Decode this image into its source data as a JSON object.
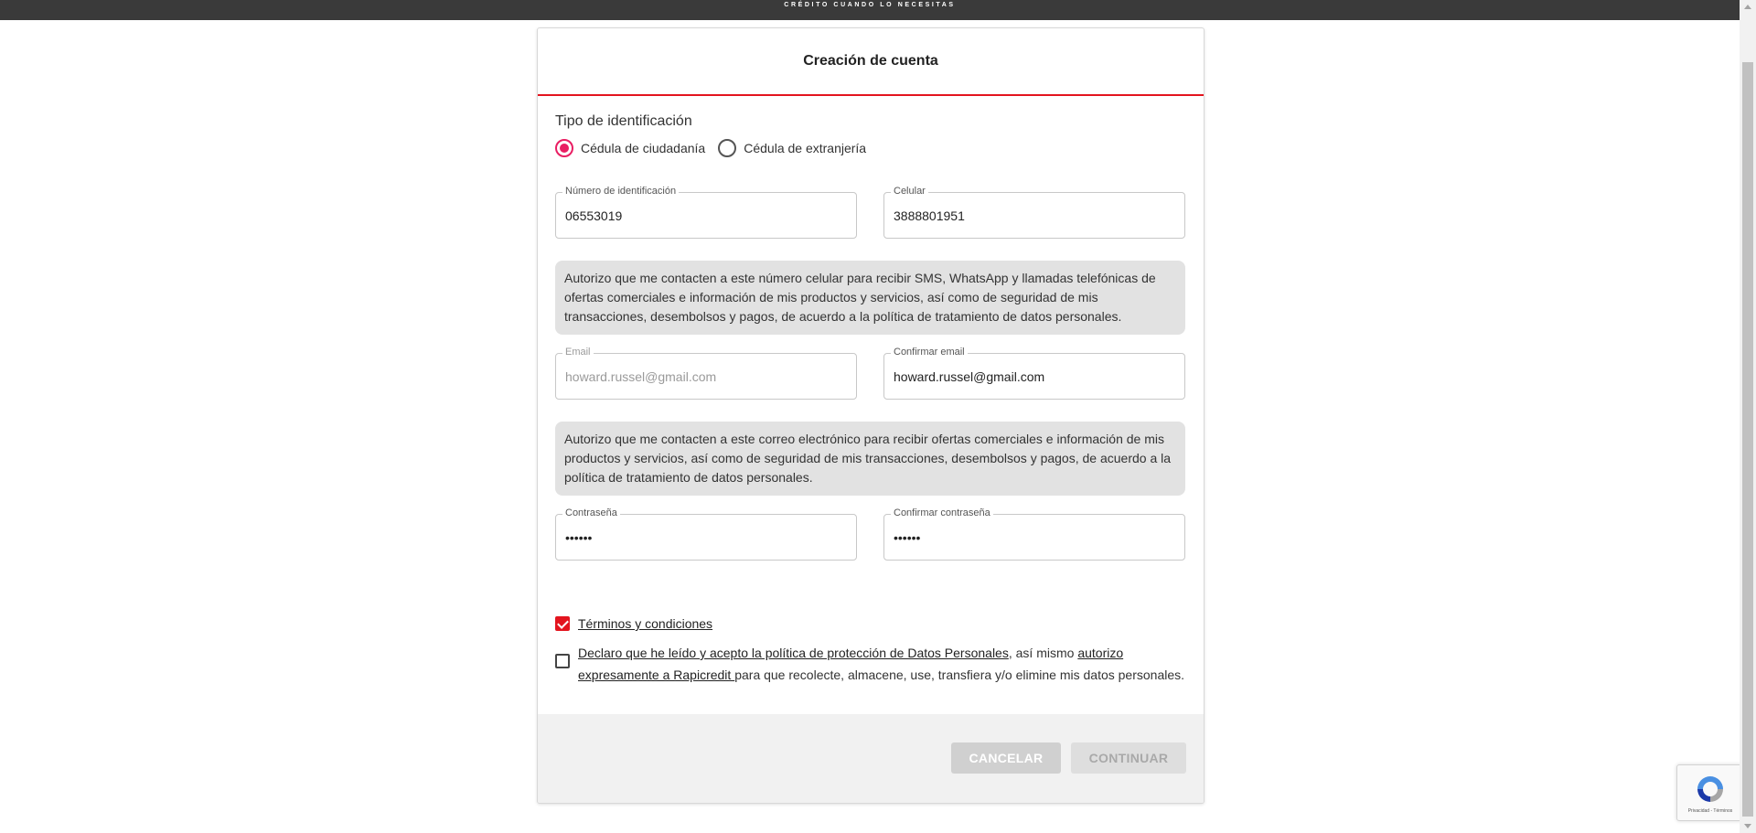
{
  "header": {
    "tagline": "CRÉDITO CUANDO LO NECESITAS"
  },
  "card": {
    "title": "Creación de cuenta"
  },
  "id_type": {
    "title": "Tipo de identificación",
    "options": [
      {
        "label": "Cédula de ciudadanía",
        "selected": true
      },
      {
        "label": "Cédula de extranjería",
        "selected": false
      }
    ]
  },
  "fields": {
    "id_number": {
      "label": "Número de identificación",
      "value": "06553019"
    },
    "phone": {
      "label": "Celular",
      "value": "3888801951"
    },
    "email": {
      "label": "Email",
      "value": "howard.russel@gmail.com"
    },
    "confirm_email": {
      "label": "Confirmar email",
      "value": "howard.russel@gmail.com"
    },
    "password": {
      "label": "Contraseña",
      "value": "••••••"
    },
    "confirm_password": {
      "label": "Confirmar contraseña",
      "value": "••••••"
    }
  },
  "notices": {
    "phone": "Autorizo que me contacten a este número celular para recibir SMS, WhatsApp y llamadas telefónicas de ofertas comerciales e información de mis productos y servicios, así como de seguridad de mis transacciones, desembolsos y pagos, de acuerdo a la política de tratamiento de datos personales.",
    "email": "Autorizo que me contacten a este correo electrónico para recibir ofertas comerciales e información de mis productos y servicios, así como de seguridad de mis transacciones, desembolsos y pagos, de acuerdo a la política de tratamiento de datos personales."
  },
  "consents": {
    "terms": {
      "link": " Términos y condiciones ",
      "checked": true
    },
    "privacy": {
      "link1": " Declaro que he leído y acepto la política de protección de Datos Personales",
      "text1": ", así mismo ",
      "link2": "autorizo expresamente a Rapicredit ",
      "text2": "para que recolecte, almacene, use, transfiera y/o elimine mis datos personales.",
      "checked": false
    }
  },
  "buttons": {
    "cancel": "CANCELAR",
    "continue": "CONTINUAR"
  },
  "recaptcha": {
    "text": "Privacidad - Términos"
  },
  "colors": {
    "accent": "#e3141e",
    "radio": "#e91e63",
    "notice_bg": "#e2e2e2",
    "footer_bg": "#f1f1f1"
  }
}
